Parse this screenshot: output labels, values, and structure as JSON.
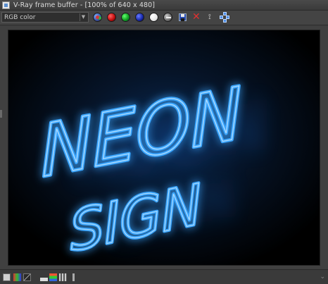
{
  "window": {
    "title": "V-Ray frame buffer - [100% of 640 x 480]"
  },
  "toolbar": {
    "channel_select": {
      "value": "RGB color"
    },
    "buttons": [
      {
        "name": "rgb-channels-icon"
      },
      {
        "name": "red-channel-icon"
      },
      {
        "name": "green-channel-icon"
      },
      {
        "name": "blue-channel-icon"
      },
      {
        "name": "alpha-channel-icon"
      },
      {
        "name": "monochrome-icon"
      },
      {
        "name": "save-image-icon"
      },
      {
        "name": "clear-image-icon"
      },
      {
        "name": "pin-icon"
      },
      {
        "name": "distributed-render-icon"
      }
    ]
  },
  "render": {
    "line1": "NEON",
    "line2": "SIGN",
    "glow_color": "#1e8cff",
    "tube_color": "#49b3ff"
  },
  "colors": {
    "accent_red": "#d42a2a",
    "accent_green": "#12a020",
    "accent_blue": "#1a2cb0"
  }
}
